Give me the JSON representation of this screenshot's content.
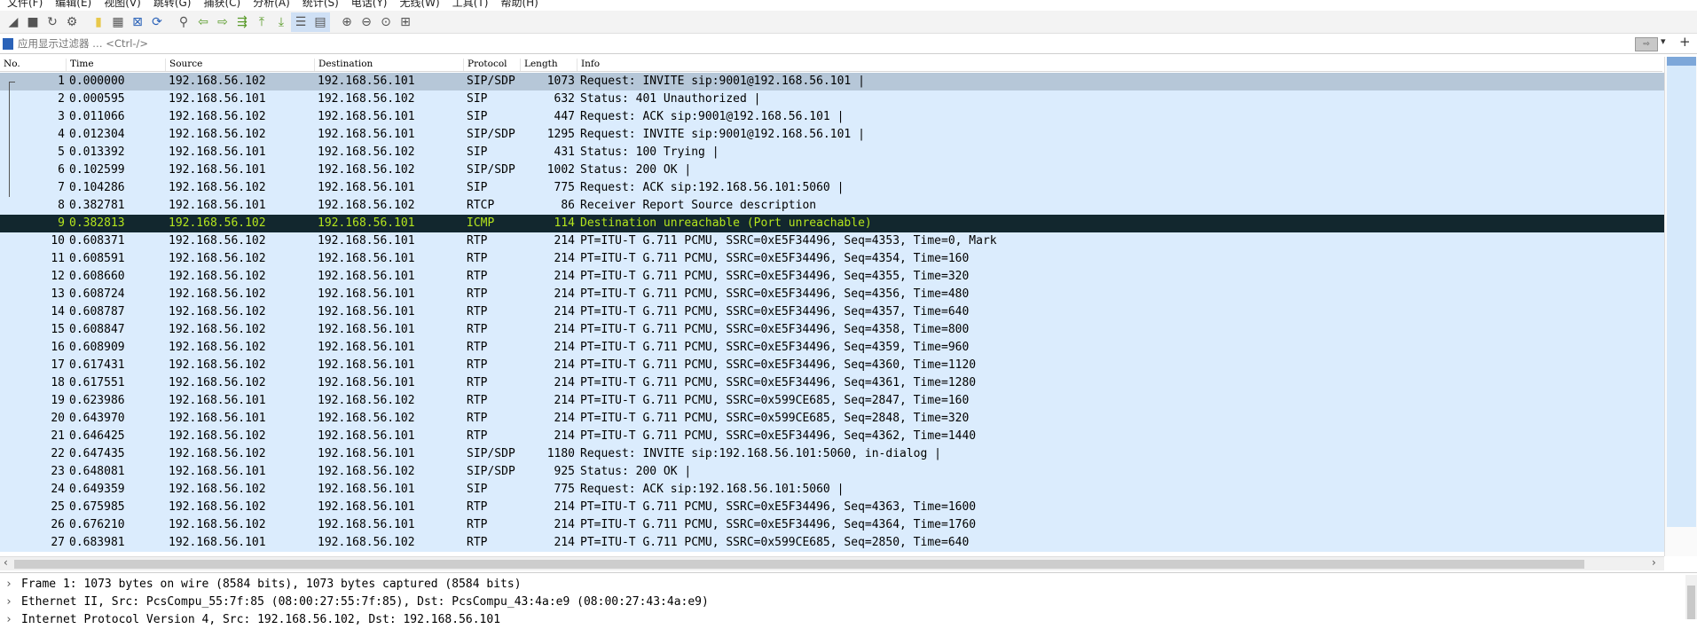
{
  "menu": [
    "文件(F)",
    "编辑(E)",
    "视图(V)",
    "跳转(G)",
    "捕获(C)",
    "分析(A)",
    "统计(S)",
    "电话(Y)",
    "无线(W)",
    "工具(T)",
    "帮助(H)"
  ],
  "filter": {
    "placeholder": "应用显示过滤器 … <Ctrl-/>"
  },
  "columns": {
    "no": "No.",
    "time": "Time",
    "source": "Source",
    "destination": "Destination",
    "protocol": "Protocol",
    "length": "Length",
    "info": "Info"
  },
  "colors": {
    "row_bg": "#dbecfd",
    "selected_bg": "#b6c7d8",
    "icmp_bg": "#12272e",
    "icmp_fg": "#b5e61d"
  },
  "packets": [
    {
      "no": "1",
      "time": "0.000000",
      "src": "192.168.56.102",
      "dst": "192.168.56.101",
      "proto": "SIP/SDP",
      "len": "1073",
      "info": "Request: INVITE sip:9001@192.168.56.101 |"
    },
    {
      "no": "2",
      "time": "0.000595",
      "src": "192.168.56.101",
      "dst": "192.168.56.102",
      "proto": "SIP",
      "len": "632",
      "info": "Status: 401 Unauthorized |"
    },
    {
      "no": "3",
      "time": "0.011066",
      "src": "192.168.56.102",
      "dst": "192.168.56.101",
      "proto": "SIP",
      "len": "447",
      "info": "Request: ACK sip:9001@192.168.56.101 |"
    },
    {
      "no": "4",
      "time": "0.012304",
      "src": "192.168.56.102",
      "dst": "192.168.56.101",
      "proto": "SIP/SDP",
      "len": "1295",
      "info": "Request: INVITE sip:9001@192.168.56.101 |"
    },
    {
      "no": "5",
      "time": "0.013392",
      "src": "192.168.56.101",
      "dst": "192.168.56.102",
      "proto": "SIP",
      "len": "431",
      "info": "Status: 100 Trying |"
    },
    {
      "no": "6",
      "time": "0.102599",
      "src": "192.168.56.101",
      "dst": "192.168.56.102",
      "proto": "SIP/SDP",
      "len": "1002",
      "info": "Status: 200 OK |"
    },
    {
      "no": "7",
      "time": "0.104286",
      "src": "192.168.56.102",
      "dst": "192.168.56.101",
      "proto": "SIP",
      "len": "775",
      "info": "Request: ACK sip:192.168.56.101:5060 |"
    },
    {
      "no": "8",
      "time": "0.382781",
      "src": "192.168.56.101",
      "dst": "192.168.56.102",
      "proto": "RTCP",
      "len": "86",
      "info": "Receiver Report   Source description"
    },
    {
      "no": "9",
      "time": "0.382813",
      "src": "192.168.56.102",
      "dst": "192.168.56.101",
      "proto": "ICMP",
      "len": "114",
      "info": "Destination unreachable (Port unreachable)"
    },
    {
      "no": "10",
      "time": "0.608371",
      "src": "192.168.56.102",
      "dst": "192.168.56.101",
      "proto": "RTP",
      "len": "214",
      "info": "PT=ITU-T G.711 PCMU, SSRC=0xE5F34496, Seq=4353, Time=0, Mark"
    },
    {
      "no": "11",
      "time": "0.608591",
      "src": "192.168.56.102",
      "dst": "192.168.56.101",
      "proto": "RTP",
      "len": "214",
      "info": "PT=ITU-T G.711 PCMU, SSRC=0xE5F34496, Seq=4354, Time=160"
    },
    {
      "no": "12",
      "time": "0.608660",
      "src": "192.168.56.102",
      "dst": "192.168.56.101",
      "proto": "RTP",
      "len": "214",
      "info": "PT=ITU-T G.711 PCMU, SSRC=0xE5F34496, Seq=4355, Time=320"
    },
    {
      "no": "13",
      "time": "0.608724",
      "src": "192.168.56.102",
      "dst": "192.168.56.101",
      "proto": "RTP",
      "len": "214",
      "info": "PT=ITU-T G.711 PCMU, SSRC=0xE5F34496, Seq=4356, Time=480"
    },
    {
      "no": "14",
      "time": "0.608787",
      "src": "192.168.56.102",
      "dst": "192.168.56.101",
      "proto": "RTP",
      "len": "214",
      "info": "PT=ITU-T G.711 PCMU, SSRC=0xE5F34496, Seq=4357, Time=640"
    },
    {
      "no": "15",
      "time": "0.608847",
      "src": "192.168.56.102",
      "dst": "192.168.56.101",
      "proto": "RTP",
      "len": "214",
      "info": "PT=ITU-T G.711 PCMU, SSRC=0xE5F34496, Seq=4358, Time=800"
    },
    {
      "no": "16",
      "time": "0.608909",
      "src": "192.168.56.102",
      "dst": "192.168.56.101",
      "proto": "RTP",
      "len": "214",
      "info": "PT=ITU-T G.711 PCMU, SSRC=0xE5F34496, Seq=4359, Time=960"
    },
    {
      "no": "17",
      "time": "0.617431",
      "src": "192.168.56.102",
      "dst": "192.168.56.101",
      "proto": "RTP",
      "len": "214",
      "info": "PT=ITU-T G.711 PCMU, SSRC=0xE5F34496, Seq=4360, Time=1120"
    },
    {
      "no": "18",
      "time": "0.617551",
      "src": "192.168.56.102",
      "dst": "192.168.56.101",
      "proto": "RTP",
      "len": "214",
      "info": "PT=ITU-T G.711 PCMU, SSRC=0xE5F34496, Seq=4361, Time=1280"
    },
    {
      "no": "19",
      "time": "0.623986",
      "src": "192.168.56.101",
      "dst": "192.168.56.102",
      "proto": "RTP",
      "len": "214",
      "info": "PT=ITU-T G.711 PCMU, SSRC=0x599CE685, Seq=2847, Time=160"
    },
    {
      "no": "20",
      "time": "0.643970",
      "src": "192.168.56.101",
      "dst": "192.168.56.102",
      "proto": "RTP",
      "len": "214",
      "info": "PT=ITU-T G.711 PCMU, SSRC=0x599CE685, Seq=2848, Time=320"
    },
    {
      "no": "21",
      "time": "0.646425",
      "src": "192.168.56.102",
      "dst": "192.168.56.101",
      "proto": "RTP",
      "len": "214",
      "info": "PT=ITU-T G.711 PCMU, SSRC=0xE5F34496, Seq=4362, Time=1440"
    },
    {
      "no": "22",
      "time": "0.647435",
      "src": "192.168.56.102",
      "dst": "192.168.56.101",
      "proto": "SIP/SDP",
      "len": "1180",
      "info": "Request: INVITE sip:192.168.56.101:5060, in-dialog |"
    },
    {
      "no": "23",
      "time": "0.648081",
      "src": "192.168.56.101",
      "dst": "192.168.56.102",
      "proto": "SIP/SDP",
      "len": "925",
      "info": "Status: 200 OK |"
    },
    {
      "no": "24",
      "time": "0.649359",
      "src": "192.168.56.102",
      "dst": "192.168.56.101",
      "proto": "SIP",
      "len": "775",
      "info": "Request: ACK sip:192.168.56.101:5060 |"
    },
    {
      "no": "25",
      "time": "0.675985",
      "src": "192.168.56.102",
      "dst": "192.168.56.101",
      "proto": "RTP",
      "len": "214",
      "info": "PT=ITU-T G.711 PCMU, SSRC=0xE5F34496, Seq=4363, Time=1600"
    },
    {
      "no": "26",
      "time": "0.676210",
      "src": "192.168.56.102",
      "dst": "192.168.56.101",
      "proto": "RTP",
      "len": "214",
      "info": "PT=ITU-T G.711 PCMU, SSRC=0xE5F34496, Seq=4364, Time=1760"
    },
    {
      "no": "27",
      "time": "0.683981",
      "src": "192.168.56.101",
      "dst": "192.168.56.102",
      "proto": "RTP",
      "len": "214",
      "info": "PT=ITU-T G.711 PCMU, SSRC=0x599CE685, Seq=2850, Time=640"
    }
  ],
  "details": [
    "Frame 1: 1073 bytes on wire (8584 bits), 1073 bytes captured (8584 bits)",
    "Ethernet II, Src: PcsCompu_55:7f:85 (08:00:27:55:7f:85), Dst: PcsCompu_43:4a:e9 (08:00:27:43:4a:e9)",
    "Internet Protocol Version 4, Src: 192.168.56.102, Dst: 192.168.56.101"
  ]
}
